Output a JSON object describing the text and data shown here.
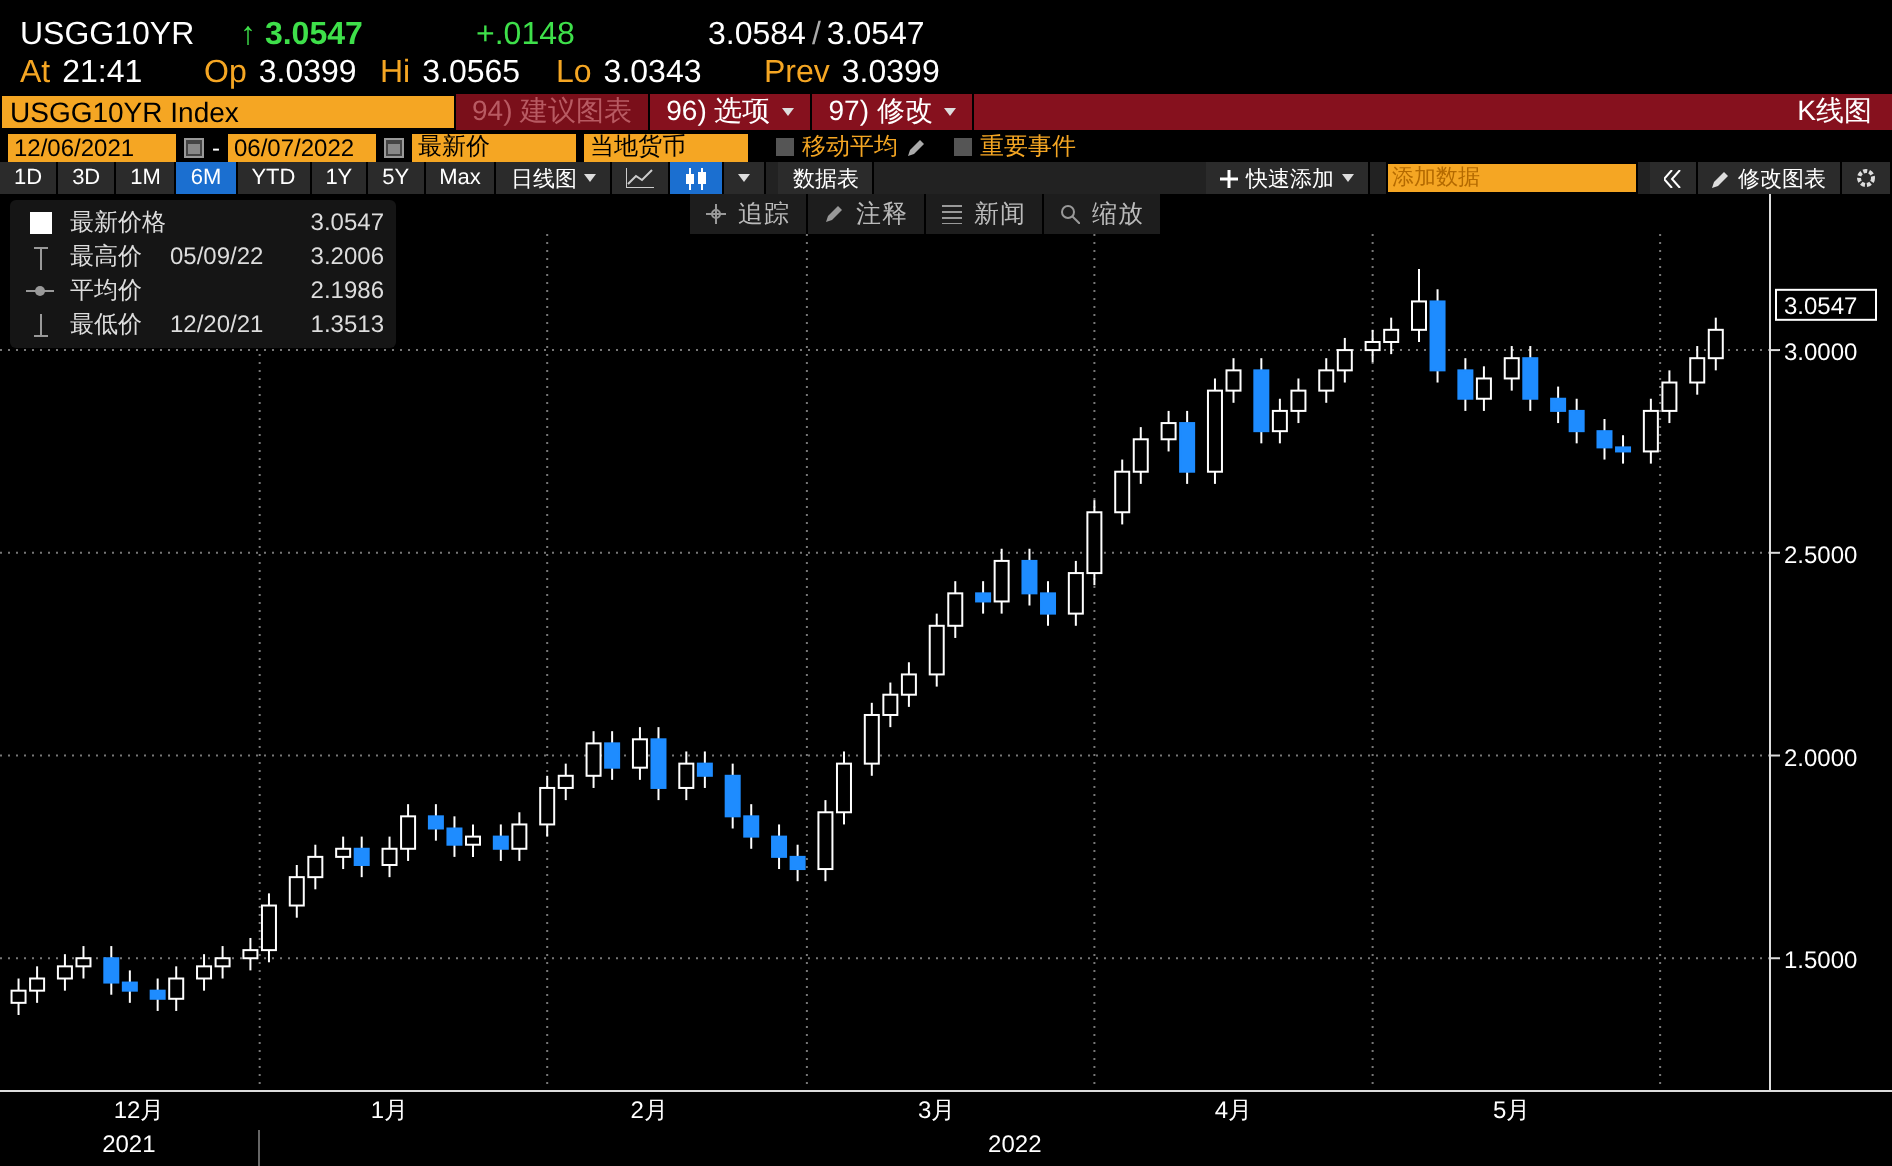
{
  "quote": {
    "ticker": "USGG10YR",
    "arrow": "↑",
    "last": "3.0547",
    "change": "+.0148",
    "bid": "3.0584",
    "separator": "/",
    "ask": "3.0547",
    "fields": [
      {
        "label": "At",
        "value": "21:41"
      },
      {
        "label": "Op",
        "value": "3.0399"
      },
      {
        "label": "Hi",
        "value": "3.0565"
      },
      {
        "label": "Lo",
        "value": "3.0343"
      },
      {
        "label": "Prev",
        "value": "3.0399"
      }
    ]
  },
  "title_bar": {
    "security": "USGG10YR Index",
    "menus": [
      {
        "number": "94)",
        "label": "建议图表",
        "disabled": true,
        "dropdown": false
      },
      {
        "number": "96)",
        "label": "选项",
        "disabled": false,
        "dropdown": true
      },
      {
        "number": "97)",
        "label": "修改",
        "disabled": false,
        "dropdown": true
      }
    ],
    "chart_type": "K线图"
  },
  "settings": {
    "start_date": "12/06/2021",
    "date_separator": "-",
    "end_date": "06/07/2022",
    "price_field": "最新价",
    "currency": "当地货币",
    "options": [
      {
        "label": "移动平均",
        "checked": false,
        "editable": true
      },
      {
        "label": "重要事件",
        "checked": false,
        "editable": false
      }
    ]
  },
  "toolbar": {
    "periods": [
      {
        "label": "1D",
        "selected": false
      },
      {
        "label": "3D",
        "selected": false
      },
      {
        "label": "1M",
        "selected": false
      },
      {
        "label": "6M",
        "selected": true
      },
      {
        "label": "YTD",
        "selected": false
      },
      {
        "label": "1Y",
        "selected": false
      },
      {
        "label": "5Y",
        "selected": false
      },
      {
        "label": "Max",
        "selected": false
      }
    ],
    "frequency": "日线图",
    "styles": [
      {
        "kind": "line",
        "selected": false
      },
      {
        "kind": "candle",
        "selected": true
      }
    ],
    "data_table": "数据表",
    "quick_add": "快速添加",
    "add_data_placeholder": "添加数据",
    "edit_chart": "修改图表"
  },
  "annotation_tools": [
    {
      "kind": "track",
      "label": "追踪"
    },
    {
      "kind": "note",
      "label": "注释"
    },
    {
      "kind": "news",
      "label": "新闻"
    },
    {
      "kind": "zoom",
      "label": "缩放"
    }
  ],
  "legend": [
    {
      "kind": "last",
      "label": "最新价格",
      "value": "3.0547"
    },
    {
      "kind": "high",
      "label": "最高价",
      "date": "05/09/22",
      "value": "3.2006"
    },
    {
      "kind": "avg",
      "label": "平均价",
      "value": "2.1986"
    },
    {
      "kind": "low",
      "label": "最低价",
      "date": "12/20/21",
      "value": "1.3513"
    }
  ],
  "chart": {
    "last_price_tag": "3.0547",
    "years": [
      "2021",
      "2022"
    ],
    "chart_data": {
      "type": "candlestick",
      "grid": true,
      "xlim": [
        "2021-12-04",
        "2022-06-26"
      ],
      "xticks": [
        {
          "value": "2021-12-19",
          "label": "12月"
        },
        {
          "value": "2022-01-15",
          "label": "1月"
        },
        {
          "value": "2022-02-12",
          "label": "2月"
        },
        {
          "value": "2022-03-15",
          "label": "3月"
        },
        {
          "value": "2022-04-16",
          "label": "4月"
        },
        {
          "value": "2022-05-16",
          "label": "5月"
        }
      ],
      "ylim": [
        1.175,
        3.385
      ],
      "yticks": [
        {
          "value": 1.5,
          "label": "1.5000"
        },
        {
          "value": 2.0,
          "label": "2.0000"
        },
        {
          "value": 2.5,
          "label": "2.5000"
        },
        {
          "value": 3.0,
          "label": "3.0000"
        }
      ],
      "x": [
        "2021-12-06",
        "2021-12-08",
        "2021-12-11",
        "2021-12-13",
        "2021-12-16",
        "2021-12-18",
        "2021-12-21",
        "2021-12-23",
        "2021-12-26",
        "2021-12-28",
        "2021-12-31",
        "2022-01-02",
        "2022-01-05",
        "2022-01-07",
        "2022-01-10",
        "2022-01-12",
        "2022-01-15",
        "2022-01-17",
        "2022-01-20",
        "2022-01-22",
        "2022-01-24",
        "2022-01-27",
        "2022-01-29",
        "2022-02-01",
        "2022-02-03",
        "2022-02-06",
        "2022-02-08",
        "2022-02-11",
        "2022-02-13",
        "2022-02-16",
        "2022-02-18",
        "2022-02-21",
        "2022-02-23",
        "2022-02-26",
        "2022-02-28",
        "2022-03-03",
        "2022-03-05",
        "2022-03-08",
        "2022-03-10",
        "2022-03-12",
        "2022-03-15",
        "2022-03-17",
        "2022-03-20",
        "2022-03-22",
        "2022-03-25",
        "2022-03-27",
        "2022-03-30",
        "2022-04-01",
        "2022-04-04",
        "2022-04-06",
        "2022-04-09",
        "2022-04-11",
        "2022-04-14",
        "2022-04-16",
        "2022-04-19",
        "2022-04-21",
        "2022-04-23",
        "2022-04-26",
        "2022-04-28",
        "2022-05-01",
        "2022-05-03",
        "2022-05-06",
        "2022-05-08",
        "2022-05-11",
        "2022-05-13",
        "2022-05-16",
        "2022-05-18",
        "2022-05-21",
        "2022-05-23",
        "2022-05-26",
        "2022-05-28",
        "2022-05-31",
        "2022-06-02",
        "2022-06-05",
        "2022-06-07"
      ],
      "ohlc": [
        [
          1.39,
          1.45,
          1.36,
          1.42
        ],
        [
          1.42,
          1.48,
          1.39,
          1.45
        ],
        [
          1.45,
          1.51,
          1.42,
          1.48
        ],
        [
          1.48,
          1.53,
          1.45,
          1.5
        ],
        [
          1.5,
          1.53,
          1.41,
          1.44
        ],
        [
          1.44,
          1.47,
          1.39,
          1.42
        ],
        [
          1.42,
          1.45,
          1.37,
          1.4
        ],
        [
          1.4,
          1.48,
          1.37,
          1.45
        ],
        [
          1.45,
          1.51,
          1.42,
          1.48
        ],
        [
          1.48,
          1.53,
          1.45,
          1.5
        ],
        [
          1.5,
          1.55,
          1.47,
          1.52
        ],
        [
          1.52,
          1.66,
          1.49,
          1.63
        ],
        [
          1.63,
          1.73,
          1.6,
          1.7
        ],
        [
          1.7,
          1.78,
          1.67,
          1.75
        ],
        [
          1.75,
          1.8,
          1.72,
          1.77
        ],
        [
          1.77,
          1.8,
          1.7,
          1.73
        ],
        [
          1.73,
          1.8,
          1.7,
          1.77
        ],
        [
          1.77,
          1.88,
          1.74,
          1.85
        ],
        [
          1.85,
          1.88,
          1.79,
          1.82
        ],
        [
          1.82,
          1.85,
          1.75,
          1.78
        ],
        [
          1.78,
          1.83,
          1.75,
          1.8
        ],
        [
          1.8,
          1.83,
          1.74,
          1.77
        ],
        [
          1.77,
          1.86,
          1.74,
          1.83
        ],
        [
          1.83,
          1.95,
          1.8,
          1.92
        ],
        [
          1.92,
          1.98,
          1.89,
          1.95
        ],
        [
          1.95,
          2.06,
          1.92,
          2.03
        ],
        [
          2.03,
          2.06,
          1.94,
          1.97
        ],
        [
          1.97,
          2.07,
          1.94,
          2.04
        ],
        [
          2.04,
          2.07,
          1.89,
          1.92
        ],
        [
          1.92,
          2.01,
          1.89,
          1.98
        ],
        [
          1.98,
          2.01,
          1.92,
          1.95
        ],
        [
          1.95,
          1.98,
          1.82,
          1.85
        ],
        [
          1.85,
          1.88,
          1.77,
          1.8
        ],
        [
          1.8,
          1.83,
          1.72,
          1.75
        ],
        [
          1.75,
          1.78,
          1.69,
          1.72
        ],
        [
          1.72,
          1.89,
          1.69,
          1.86
        ],
        [
          1.86,
          2.01,
          1.83,
          1.98
        ],
        [
          1.98,
          2.13,
          1.95,
          2.1
        ],
        [
          2.1,
          2.18,
          2.07,
          2.15
        ],
        [
          2.15,
          2.23,
          2.12,
          2.2
        ],
        [
          2.2,
          2.35,
          2.17,
          2.32
        ],
        [
          2.32,
          2.43,
          2.29,
          2.4
        ],
        [
          2.4,
          2.43,
          2.35,
          2.38
        ],
        [
          2.38,
          2.51,
          2.35,
          2.48
        ],
        [
          2.48,
          2.51,
          2.37,
          2.4
        ],
        [
          2.4,
          2.43,
          2.32,
          2.35
        ],
        [
          2.35,
          2.48,
          2.32,
          2.45
        ],
        [
          2.45,
          2.63,
          2.42,
          2.6
        ],
        [
          2.6,
          2.73,
          2.57,
          2.7
        ],
        [
          2.7,
          2.81,
          2.67,
          2.78
        ],
        [
          2.78,
          2.85,
          2.75,
          2.82
        ],
        [
          2.82,
          2.85,
          2.67,
          2.7
        ],
        [
          2.7,
          2.93,
          2.67,
          2.9
        ],
        [
          2.9,
          2.98,
          2.87,
          2.95
        ],
        [
          2.95,
          2.98,
          2.77,
          2.8
        ],
        [
          2.8,
          2.88,
          2.77,
          2.85
        ],
        [
          2.85,
          2.93,
          2.82,
          2.9
        ],
        [
          2.9,
          2.98,
          2.87,
          2.95
        ],
        [
          2.95,
          3.03,
          2.92,
          3.0
        ],
        [
          3.0,
          3.05,
          2.97,
          3.02
        ],
        [
          3.02,
          3.08,
          2.99,
          3.05
        ],
        [
          3.05,
          3.2,
          3.02,
          3.12
        ],
        [
          3.12,
          3.15,
          2.92,
          2.95
        ],
        [
          2.95,
          2.98,
          2.85,
          2.88
        ],
        [
          2.88,
          2.96,
          2.85,
          2.93
        ],
        [
          2.93,
          3.01,
          2.9,
          2.98
        ],
        [
          2.98,
          3.01,
          2.85,
          2.88
        ],
        [
          2.88,
          2.91,
          2.82,
          2.85
        ],
        [
          2.85,
          2.88,
          2.77,
          2.8
        ],
        [
          2.8,
          2.83,
          2.73,
          2.76
        ],
        [
          2.76,
          2.79,
          2.72,
          2.75
        ],
        [
          2.75,
          2.88,
          2.72,
          2.85
        ],
        [
          2.85,
          2.95,
          2.82,
          2.92
        ],
        [
          2.92,
          3.01,
          2.89,
          2.98
        ],
        [
          2.98,
          3.08,
          2.95,
          3.05
        ]
      ]
    }
  }
}
